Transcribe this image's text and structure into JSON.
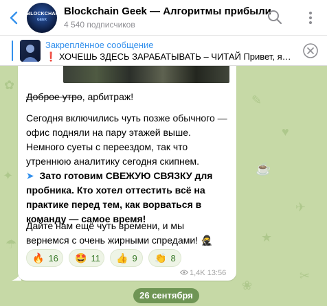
{
  "header": {
    "avatar_text": "BLOCKCHAIN",
    "avatar_subtext": "GEEK",
    "title": "Blockchain Geek — Алгоритмы прибыли",
    "subscribers": "4 540 подписчиков"
  },
  "pinned": {
    "label": "Закреплённое сообщение",
    "emoji": "❗",
    "text": "ХОЧЕШЬ ЗДЕСЬ ЗАРАБАТЫВАТЬ – ЧИТАЙ  Привет, я…"
  },
  "message": {
    "greeting_struck": "Доброе утро",
    "greeting_rest": ", арбитраж!",
    "paragraph1": "Сегодня включились чуть позже обычного — офис подняли на пару этажей выше. Немного суеты с переездом, так что утреннюю аналитику сегодня скипнем.",
    "arrow": "➤",
    "paragraph2": "Зато готовим СВЕЖУЮ СВЯЗКУ для пробника. Кто хотел оттестить всё на практике перед тем, как ворваться в команду — самое время!",
    "paragraph3": "Дайте нам ещё чуть времени, и мы вернемся с очень жирными спредами!",
    "paragraph3_emoji": "🥷",
    "reactions": [
      {
        "emoji": "🔥",
        "count": "16"
      },
      {
        "emoji": "🤩",
        "count": "11"
      },
      {
        "emoji": "👍",
        "count": "9"
      },
      {
        "emoji": "👏",
        "count": "8"
      }
    ],
    "views": "1,4K",
    "time": "13:56"
  },
  "date_separator": "26 сентября",
  "colors": {
    "accent": "#3390ec",
    "chat_background": "#c6d9a6",
    "date_pill": "#527e3a",
    "reaction_text": "#3a7a2a"
  },
  "icons": {
    "back": "chevron-left-icon",
    "search": "search-icon",
    "menu": "more-vertical-icon",
    "pinned_close": "close-circle-icon",
    "views": "eye-icon"
  }
}
